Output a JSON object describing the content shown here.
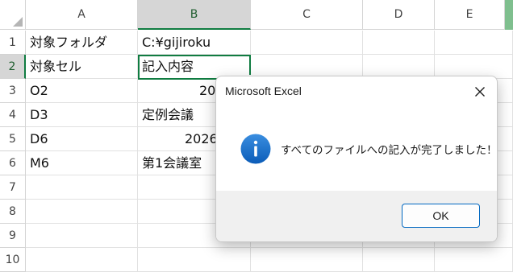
{
  "spreadsheet": {
    "columns": [
      "A",
      "B",
      "C",
      "D",
      "E"
    ],
    "rows": [
      "1",
      "2",
      "3",
      "4",
      "5",
      "6",
      "7",
      "8",
      "9",
      "10"
    ],
    "cells": {
      "A1": "対象フォルダ",
      "B1": "C:¥gijiroku",
      "A2": "対象セル",
      "B2": "記入内容",
      "A3": "O2",
      "B3": "2026/",
      "A4": "D3",
      "B4": "定例会議",
      "A5": "D6",
      "B5": "2026",
      "A6": "M6",
      "B6": "第1会議室"
    },
    "selected_cell": "B2"
  },
  "dialog": {
    "title": "Microsoft Excel",
    "message": "すべてのファイルへの記入が完了しました！",
    "ok_label": "OK",
    "icon": "info-icon",
    "accent_color": "#0067c0"
  },
  "colors": {
    "excel_green": "#107c41"
  }
}
